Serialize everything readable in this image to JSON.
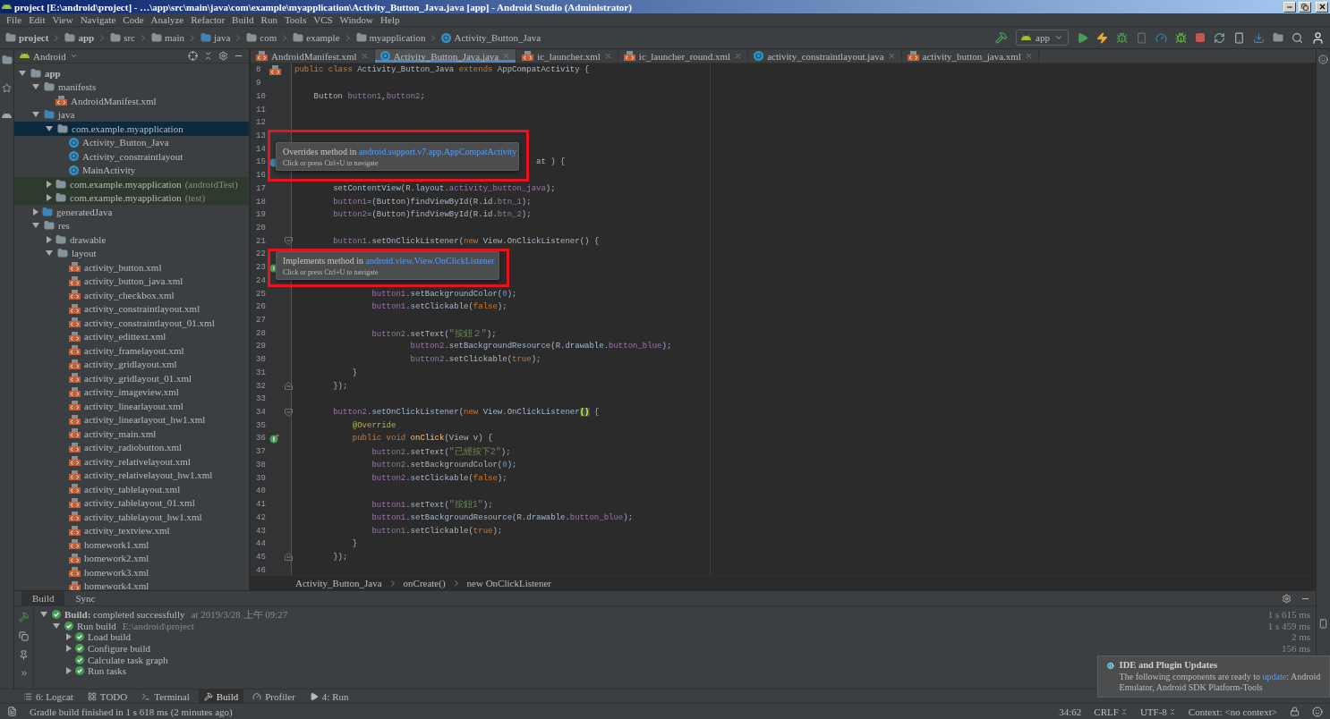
{
  "window": {
    "title": "project [E:\\android\\project] - …\\app\\src\\main\\java\\com\\example\\myapplication\\Activity_Button_Java.java [app] - Android Studio (Administrator)"
  },
  "menu": [
    "File",
    "Edit",
    "View",
    "Navigate",
    "Code",
    "Analyze",
    "Refactor",
    "Build",
    "Run",
    "Tools",
    "VCS",
    "Window",
    "Help"
  ],
  "breadcrumbs": [
    {
      "label": "project",
      "kind": "project"
    },
    {
      "label": "app",
      "kind": "module"
    },
    {
      "label": "src",
      "kind": "folder"
    },
    {
      "label": "main",
      "kind": "folder"
    },
    {
      "label": "java",
      "kind": "source"
    },
    {
      "label": "com",
      "kind": "folder"
    },
    {
      "label": "example",
      "kind": "folder"
    },
    {
      "label": "myapplication",
      "kind": "folder"
    },
    {
      "label": "Activity_Button_Java",
      "kind": "class"
    }
  ],
  "run_config": "app",
  "project_panel": {
    "view": "Android",
    "tree": [
      {
        "label": "app",
        "kind": "module",
        "expanded": true,
        "selected": false,
        "children": [
          {
            "label": "manifests",
            "kind": "folder",
            "expanded": true,
            "selected": false,
            "children": [
              {
                "label": "AndroidManifest.xml",
                "kind": "manifest",
                "selected": false
              }
            ]
          },
          {
            "label": "java",
            "kind": "source",
            "expanded": true,
            "selected": false,
            "children": [
              {
                "label": "com.example.myapplication",
                "kind": "package",
                "expanded": true,
                "selected": true,
                "children": [
                  {
                    "label": "Activity_Button_Java",
                    "kind": "class",
                    "selected": false
                  },
                  {
                    "label": "Activity_constraintlayout",
                    "kind": "class",
                    "selected": false
                  },
                  {
                    "label": "MainActivity",
                    "kind": "class",
                    "selected": false
                  }
                ]
              },
              {
                "label": "com.example.myapplication",
                "note": "(androidTest)",
                "kind": "test-package",
                "expanded": false,
                "selected": false
              },
              {
                "label": "com.example.myapplication",
                "note": "(test)",
                "kind": "test-package",
                "expanded": false,
                "selected": false
              }
            ]
          },
          {
            "label": "generatedJava",
            "kind": "source",
            "expanded": false,
            "selected": false
          },
          {
            "label": "res",
            "kind": "folder",
            "expanded": true,
            "selected": false,
            "children": [
              {
                "label": "drawable",
                "kind": "folder",
                "expanded": false,
                "selected": false
              },
              {
                "label": "layout",
                "kind": "folder",
                "expanded": true,
                "selected": false,
                "children": [
                  {
                    "label": "activity_button.xml",
                    "kind": "layout",
                    "selected": false
                  },
                  {
                    "label": "activity_button_java.xml",
                    "kind": "layout",
                    "selected": false
                  },
                  {
                    "label": "activity_checkbox.xml",
                    "kind": "layout",
                    "selected": false
                  },
                  {
                    "label": "activity_constraintlayout.xml",
                    "kind": "layout",
                    "selected": false
                  },
                  {
                    "label": "activity_constraintlayout_01.xml",
                    "kind": "layout",
                    "selected": false
                  },
                  {
                    "label": "activity_edittext.xml",
                    "kind": "layout",
                    "selected": false
                  },
                  {
                    "label": "activity_framelayout.xml",
                    "kind": "layout",
                    "selected": false
                  },
                  {
                    "label": "activity_gridlayout.xml",
                    "kind": "layout",
                    "selected": false
                  },
                  {
                    "label": "activity_gridlayout_01.xml",
                    "kind": "layout",
                    "selected": false
                  },
                  {
                    "label": "activity_imageview.xml",
                    "kind": "layout",
                    "selected": false
                  },
                  {
                    "label": "activity_linearlayout.xml",
                    "kind": "layout",
                    "selected": false
                  },
                  {
                    "label": "activity_linearlayout_hw1.xml",
                    "kind": "layout",
                    "selected": false
                  },
                  {
                    "label": "activity_main.xml",
                    "kind": "layout",
                    "selected": false
                  },
                  {
                    "label": "activity_radiobutton.xml",
                    "kind": "layout",
                    "selected": false
                  },
                  {
                    "label": "activity_relativelayout.xml",
                    "kind": "layout",
                    "selected": false
                  },
                  {
                    "label": "activity_relativelayout_hw1.xml",
                    "kind": "layout",
                    "selected": false
                  },
                  {
                    "label": "activity_tablelayout.xml",
                    "kind": "layout",
                    "selected": false
                  },
                  {
                    "label": "activity_tablelayout_01.xml",
                    "kind": "layout",
                    "selected": false
                  },
                  {
                    "label": "activity_tablelayout_hw1.xml",
                    "kind": "layout",
                    "selected": false
                  },
                  {
                    "label": "activity_textview.xml",
                    "kind": "layout",
                    "selected": false
                  },
                  {
                    "label": "homework1.xml",
                    "kind": "layout",
                    "selected": false
                  },
                  {
                    "label": "homework2.xml",
                    "kind": "layout",
                    "selected": false
                  },
                  {
                    "label": "homework3.xml",
                    "kind": "layout",
                    "selected": false
                  },
                  {
                    "label": "homework4.xml",
                    "kind": "layout",
                    "selected": false
                  }
                ]
              }
            ]
          }
        ]
      }
    ]
  },
  "editor_tabs": [
    {
      "label": "AndroidManifest.xml",
      "kind": "manifest",
      "selected": false
    },
    {
      "label": "Activity_Button_Java.java",
      "kind": "class",
      "selected": true
    },
    {
      "label": "ic_launcher.xml",
      "kind": "xml",
      "selected": false
    },
    {
      "label": "ic_launcher_round.xml",
      "kind": "xml",
      "selected": false
    },
    {
      "label": "activity_constraintlayout.java",
      "kind": "class",
      "selected": false
    },
    {
      "label": "activity_button_java.xml",
      "kind": "xml",
      "selected": false
    }
  ],
  "code_lines": [
    {
      "number": "8",
      "marker": {
        "kind": "related"
      },
      "tokens": [
        {
          "kind": "kw",
          "text": "public class "
        },
        {
          "kind": "plain",
          "text": "Activity_Button_Java "
        },
        {
          "kind": "kw",
          "text": "extends "
        },
        {
          "kind": "plain",
          "text": "AppCompatActivity {"
        }
      ]
    },
    {
      "number": "9"
    },
    {
      "number": "10",
      "tokens": [
        {
          "kind": "plain",
          "text": "    Button "
        },
        {
          "kind": "field",
          "text": "button1"
        },
        {
          "kind": "plain",
          "text": ","
        },
        {
          "kind": "field",
          "text": "button2"
        },
        {
          "kind": "plain",
          "text": ";"
        }
      ]
    },
    {
      "number": "11"
    },
    {
      "number": "12"
    },
    {
      "number": "13"
    },
    {
      "number": "14"
    },
    {
      "number": "15",
      "marker": {
        "kind": "override"
      },
      "tokens": [
        {
          "kind": "plain",
          "text": "                                                  at ) {"
        }
      ]
    },
    {
      "number": "16"
    },
    {
      "number": "17",
      "tokens": [
        {
          "kind": "plain",
          "text": "        setContentView(R.layout."
        },
        {
          "kind": "field",
          "text": "activity_button_java"
        },
        {
          "kind": "plain",
          "text": ");"
        }
      ]
    },
    {
      "number": "18",
      "tokens": [
        {
          "kind": "field",
          "text": "        button1"
        },
        {
          "kind": "plain",
          "text": "=(Button)findViewById(R.id."
        },
        {
          "kind": "field",
          "text": "btn_1"
        },
        {
          "kind": "plain",
          "text": ");"
        }
      ]
    },
    {
      "number": "19",
      "tokens": [
        {
          "kind": "field",
          "text": "        button2"
        },
        {
          "kind": "plain",
          "text": "=(Button)findViewById(R.id."
        },
        {
          "kind": "field",
          "text": "btn_2"
        },
        {
          "kind": "plain",
          "text": ");"
        }
      ]
    },
    {
      "number": "20"
    },
    {
      "number": "21",
      "fold": {
        "kind": "start"
      },
      "tokens": [
        {
          "kind": "field",
          "text": "        button1"
        },
        {
          "kind": "plain",
          "text": ".setOnClickListener("
        },
        {
          "kind": "kw",
          "text": "new "
        },
        {
          "kind": "plain",
          "text": "View.OnClickListener() {"
        }
      ]
    },
    {
      "number": "22"
    },
    {
      "number": "23",
      "marker": {
        "kind": "implements"
      }
    },
    {
      "number": "24"
    },
    {
      "number": "25",
      "tokens": [
        {
          "kind": "field",
          "text": "                button1"
        },
        {
          "kind": "plain",
          "text": ".setBackgroundColor("
        },
        {
          "kind": "num",
          "text": "0"
        },
        {
          "kind": "plain",
          "text": ");"
        }
      ]
    },
    {
      "number": "26",
      "tokens": [
        {
          "kind": "field",
          "text": "                button1"
        },
        {
          "kind": "plain",
          "text": ".setClickable("
        },
        {
          "kind": "kw",
          "text": "false"
        },
        {
          "kind": "plain",
          "text": ");"
        }
      ]
    },
    {
      "number": "27"
    },
    {
      "number": "28",
      "tokens": [
        {
          "kind": "field",
          "text": "                button2"
        },
        {
          "kind": "plain",
          "text": ".setText("
        },
        {
          "kind": "str",
          "text": "\"按鈕２\""
        },
        {
          "kind": "plain",
          "text": ");"
        }
      ]
    },
    {
      "number": "29",
      "tokens": [
        {
          "kind": "field",
          "text": "                        button2"
        },
        {
          "kind": "plain",
          "text": ".setBackgroundResource(R.drawable."
        },
        {
          "kind": "field",
          "text": "button_blue"
        },
        {
          "kind": "plain",
          "text": ");"
        }
      ]
    },
    {
      "number": "30",
      "tokens": [
        {
          "kind": "field",
          "text": "                        button2"
        },
        {
          "kind": "plain",
          "text": ".setClickable("
        },
        {
          "kind": "kw",
          "text": "true"
        },
        {
          "kind": "plain",
          "text": ");"
        }
      ]
    },
    {
      "number": "31",
      "tokens": [
        {
          "kind": "plain",
          "text": "            }"
        }
      ]
    },
    {
      "number": "32",
      "fold": {
        "kind": "end"
      },
      "tokens": [
        {
          "kind": "plain",
          "text": "        });"
        }
      ]
    },
    {
      "number": "33"
    },
    {
      "number": "34",
      "fold": {
        "kind": "start"
      },
      "tokens": [
        {
          "kind": "field",
          "text": "        button2"
        },
        {
          "kind": "plain",
          "text": ".setOnClickListener("
        },
        {
          "kind": "kw",
          "text": "new "
        },
        {
          "kind": "plain",
          "text": "View.OnClickListener"
        },
        {
          "kind": "match",
          "text": "()"
        },
        {
          "kind": "plain",
          "text": " {"
        }
      ]
    },
    {
      "number": "35",
      "tokens": [
        {
          "kind": "ann",
          "text": "            @Override"
        }
      ]
    },
    {
      "number": "36",
      "marker": {
        "kind": "implements"
      },
      "tokens": [
        {
          "kind": "kw",
          "text": "            public void "
        },
        {
          "kind": "method",
          "text": "onClick"
        },
        {
          "kind": "plain",
          "text": "(View v) {"
        }
      ]
    },
    {
      "number": "37",
      "tokens": [
        {
          "kind": "field",
          "text": "                button2"
        },
        {
          "kind": "plain",
          "text": ".setText("
        },
        {
          "kind": "str",
          "text": "\"已經按下2\""
        },
        {
          "kind": "plain",
          "text": ");"
        }
      ]
    },
    {
      "number": "38",
      "tokens": [
        {
          "kind": "field",
          "text": "                button2"
        },
        {
          "kind": "plain",
          "text": ".setBackgroundColor("
        },
        {
          "kind": "num",
          "text": "0"
        },
        {
          "kind": "plain",
          "text": ");"
        }
      ]
    },
    {
      "number": "39",
      "tokens": [
        {
          "kind": "field",
          "text": "                button2"
        },
        {
          "kind": "plain",
          "text": ".setClickable("
        },
        {
          "kind": "kw",
          "text": "false"
        },
        {
          "kind": "plain",
          "text": ");"
        }
      ]
    },
    {
      "number": "40"
    },
    {
      "number": "41",
      "tokens": [
        {
          "kind": "field",
          "text": "                button1"
        },
        {
          "kind": "plain",
          "text": ".setText("
        },
        {
          "kind": "str",
          "text": "\"按鈕1\""
        },
        {
          "kind": "plain",
          "text": ");"
        }
      ]
    },
    {
      "number": "42",
      "tokens": [
        {
          "kind": "field",
          "text": "                button1"
        },
        {
          "kind": "plain",
          "text": ".setBackgroundResource(R.drawable."
        },
        {
          "kind": "field",
          "text": "button_blue"
        },
        {
          "kind": "plain",
          "text": ");"
        }
      ]
    },
    {
      "number": "43",
      "tokens": [
        {
          "kind": "field",
          "text": "                button1"
        },
        {
          "kind": "plain",
          "text": ".setClickable("
        },
        {
          "kind": "kw",
          "text": "true"
        },
        {
          "kind": "plain",
          "text": ");"
        }
      ]
    },
    {
      "number": "44",
      "tokens": [
        {
          "kind": "plain",
          "text": "            }"
        }
      ]
    },
    {
      "number": "45",
      "fold": {
        "kind": "end"
      },
      "tokens": [
        {
          "kind": "plain",
          "text": "        });"
        }
      ]
    },
    {
      "number": "46"
    }
  ],
  "hints": [
    {
      "text": "Overrides method in ",
      "link": "android.support.v7.app.AppCompatActivity",
      "sub": "Click or press Ctrl+U to navigate"
    },
    {
      "text": "Implements method in ",
      "link": "android.view.View.OnClickListener",
      "sub": "Click or press Ctrl+U to navigate"
    }
  ],
  "editor_breadcrumbs": [
    "Activity_Button_Java",
    "onCreate()",
    "new OnClickListener"
  ],
  "build_panel": {
    "tabs": [
      {
        "label": "Build",
        "selected": true
      },
      {
        "label": "Sync",
        "selected": false
      }
    ],
    "tree": [
      {
        "label": "**Build:** completed successfully",
        "detail": "at 2019/3/28 上午 09:27",
        "time": "1 s 615 ms",
        "expanded": true,
        "children": [
          {
            "label": "Run build",
            "detail": "E:\\android\\project",
            "time": "1 s 459 ms",
            "expanded": true,
            "children": [
              {
                "label": "Load build",
                "time": "2 ms",
                "expanded": false
              },
              {
                "label": "Configure build",
                "time": "156 ms",
                "expanded": false
              },
              {
                "label": "Calculate task graph"
              },
              {
                "label": "Run tasks",
                "expanded": false
              }
            ]
          }
        ]
      }
    ]
  },
  "tool_tabs": [
    {
      "label": "6: Logcat",
      "kind": "logcat",
      "selected": false
    },
    {
      "label": "TODO",
      "kind": "todo",
      "selected": false
    },
    {
      "label": "Terminal",
      "kind": "terminal",
      "selected": false
    },
    {
      "label": "Build",
      "kind": "build",
      "selected": true
    },
    {
      "label": "Profiler",
      "kind": "profiler",
      "selected": false
    },
    {
      "label": "4: Run",
      "kind": "run",
      "selected": false
    }
  ],
  "status_bar": {
    "message": "Gradle build finished in 1 s 618 ms (2 minutes ago)",
    "position": "34:62",
    "line_separator": "CRLF",
    "encoding": "UTF-8",
    "context": "Context: <no context>"
  },
  "notification": {
    "title": "IDE and Plugin Updates",
    "text_before": "The following components are ready to ",
    "link": "update",
    "text_after": ": Android Emulator, Android SDK Platform-Tools"
  }
}
